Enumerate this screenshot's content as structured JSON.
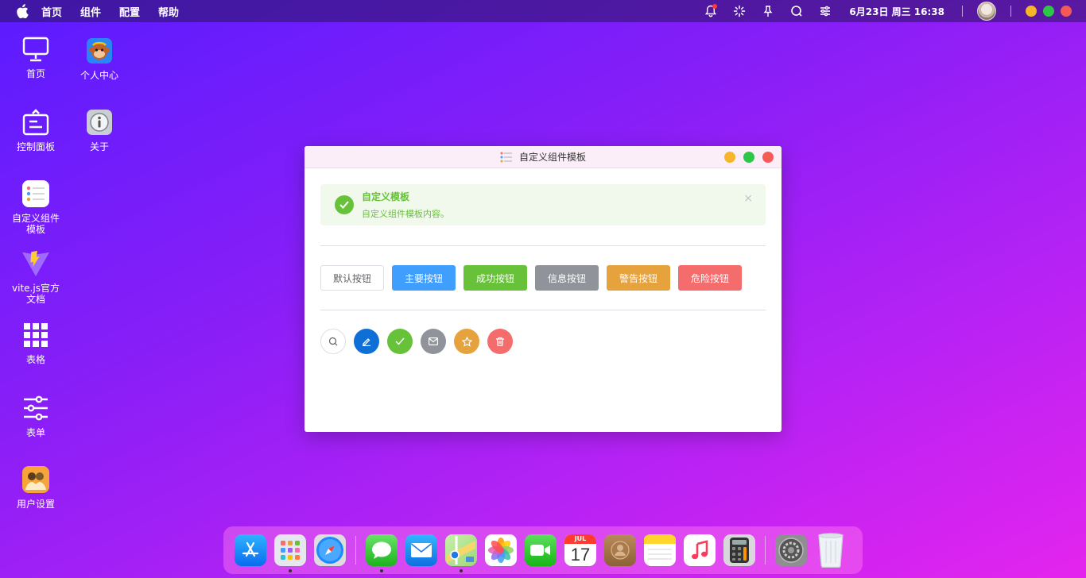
{
  "menubar": {
    "items": [
      "首页",
      "组件",
      "配置",
      "帮助"
    ],
    "clock": "6月23日 周三 16:38"
  },
  "desktop": {
    "icons": [
      {
        "label": "首页",
        "icon": "monitor-icon"
      },
      {
        "label": "控制面板",
        "icon": "panel-icon"
      },
      {
        "label": "自定义组件模板",
        "icon": "list-icon"
      },
      {
        "label": "vite.js官方文档",
        "icon": "vite-icon"
      },
      {
        "label": "表格",
        "icon": "grid-icon"
      },
      {
        "label": "表单",
        "icon": "sliders-icon"
      },
      {
        "label": "用户设置",
        "icon": "user-settings-icon"
      },
      {
        "label": "个人中心",
        "icon": "monkey-icon"
      },
      {
        "label": "关于",
        "icon": "info-icon"
      }
    ]
  },
  "window": {
    "title": "自定义组件模板",
    "alert": {
      "title": "自定义模板",
      "description": "自定义组件模板内容。",
      "close": "×"
    },
    "buttons": [
      "默认按钮",
      "主要按钮",
      "成功按钮",
      "信息按钮",
      "警告按钮",
      "危险按钮"
    ],
    "circle_buttons": [
      "search-icon",
      "edit-icon",
      "check-icon",
      "mail-icon",
      "star-icon",
      "delete-icon"
    ]
  },
  "dock": {
    "apps": [
      "app-store-icon",
      "launchpad-icon",
      "safari-icon",
      "messages-icon",
      "mail-icon",
      "maps-icon",
      "photos-icon",
      "facetime-icon",
      "calendar-icon",
      "contacts-icon",
      "notes-icon",
      "music-icon",
      "calculator-icon",
      "system-preferences-icon",
      "trash-icon"
    ],
    "calendar_month": "JUL",
    "calendar_day": "17"
  },
  "colors": {
    "primary": "#409eff",
    "success": "#67c23a",
    "info": "#909399",
    "warning": "#e6a23c",
    "danger": "#f56c6c"
  }
}
